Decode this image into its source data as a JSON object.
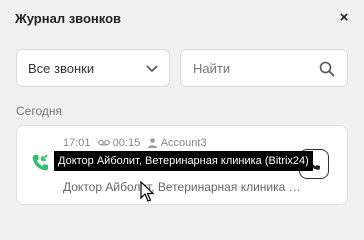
{
  "header": {
    "title": "Журнал звонков",
    "close_glyph": "×"
  },
  "filters": {
    "select_value": "Все звонки",
    "search_placeholder": "Найти"
  },
  "section": {
    "label": "Сегодня"
  },
  "calls": [
    {
      "time": "17:01",
      "duration": "00:15",
      "account": "Account3",
      "contact": "Доктор Айболит, Ветеринарная клиника (Bitrix24)",
      "direction_icon": "incoming-call-icon",
      "direction_color": "#2fc26e"
    }
  ],
  "tooltip": {
    "text": "Доктор Айболит, Ветеринарная клиника (Bitrix24)"
  }
}
